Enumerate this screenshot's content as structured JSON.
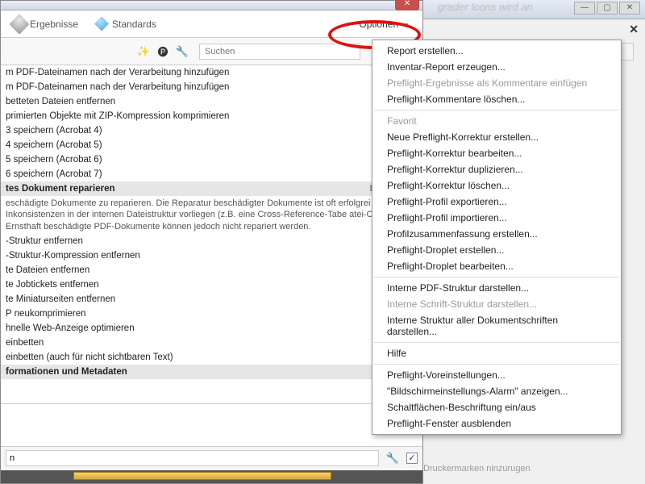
{
  "titlebar_bg_text": "grader  Icons wird an",
  "tabs": {
    "ergebnisse": "Ergebnisse",
    "standards": "Standards"
  },
  "options_label": "Optionen",
  "search_placeholder": "Suchen",
  "list_items": [
    {
      "t": "item",
      "text": "m PDF-Dateinamen nach der Verarbeitung hinzufügen"
    },
    {
      "t": "item",
      "text": "m PDF-Dateinamen nach der Verarbeitung hinzufügen"
    },
    {
      "t": "item",
      "text": "betteten Dateien entfernen"
    },
    {
      "t": "item",
      "text": "primierten Objekte mit ZIP-Kompression komprimieren"
    },
    {
      "t": "item",
      "text": "3 speichern (Acrobat 4)"
    },
    {
      "t": "item",
      "text": "4 speichern (Acrobat 5)"
    },
    {
      "t": "item",
      "text": "5 speichern (Acrobat 6)"
    },
    {
      "t": "item",
      "text": "6 speichern (Acrobat 7)"
    },
    {
      "t": "head",
      "text": "tes Dokument reparieren",
      "edit": "Bearbeiten.."
    },
    {
      "t": "desc",
      "text": "eschädigte Dokumente zu reparieren. Die Reparatur beschädigter Dokumente ist oft erfolgrei kleine Inkonsistenzen in der internen Dateistruktur vorliegen (z.B. eine Cross-Reference-Tabe atei-Offsets). Ernsthaft beschädigte PDF-Dokumente können jedoch nicht repariert werden."
    },
    {
      "t": "item",
      "text": "-Struktur entfernen"
    },
    {
      "t": "item",
      "text": "-Struktur-Kompression entfernen"
    },
    {
      "t": "item",
      "text": "te Dateien entfernen"
    },
    {
      "t": "item",
      "text": "te Jobtickets entfernen"
    },
    {
      "t": "item",
      "text": "te Miniaturseiten entfernen"
    },
    {
      "t": "item",
      "text": "P neukomprimieren"
    },
    {
      "t": "item",
      "text": "hnelle Web-Anzeige optimieren"
    },
    {
      "t": "item",
      "text": "einbetten"
    },
    {
      "t": "item",
      "text": "einbetten (auch für nicht sichtbaren Text)"
    },
    {
      "t": "head",
      "text": "formationen und Metadaten"
    }
  ],
  "footer_input": "n",
  "checkbox_checked": "✓",
  "bottom_cut_text": "Druckermarken ninzurugen",
  "dropdown": [
    {
      "t": "i",
      "label": "Report erstellen..."
    },
    {
      "t": "i",
      "label": "Inventar-Report erzeugen..."
    },
    {
      "t": "d",
      "label": "Preflight-Ergebnisse als Kommentare einfügen"
    },
    {
      "t": "i",
      "label": "Preflight-Kommentare löschen..."
    },
    {
      "t": "sep"
    },
    {
      "t": "d",
      "label": "Favorit"
    },
    {
      "t": "i",
      "label": "Neue Preflight-Korrektur erstellen..."
    },
    {
      "t": "i",
      "label": "Preflight-Korrektur bearbeiten..."
    },
    {
      "t": "i",
      "label": "Preflight-Korrektur duplizieren..."
    },
    {
      "t": "i",
      "label": "Preflight-Korrektur löschen..."
    },
    {
      "t": "i",
      "label": "Preflight-Profil exportieren..."
    },
    {
      "t": "i",
      "label": "Preflight-Profil importieren..."
    },
    {
      "t": "i",
      "label": "Profilzusammenfassung erstellen..."
    },
    {
      "t": "i",
      "label": "Preflight-Droplet erstellen..."
    },
    {
      "t": "i",
      "label": "Preflight-Droplet bearbeiten..."
    },
    {
      "t": "sep"
    },
    {
      "t": "i",
      "label": "Interne PDF-Struktur darstellen..."
    },
    {
      "t": "d",
      "label": "Interne Schrift-Struktur darstellen..."
    },
    {
      "t": "i",
      "label": "Interne Struktur aller Dokumentschriften darstellen..."
    },
    {
      "t": "sep"
    },
    {
      "t": "i",
      "label": "Hilfe"
    },
    {
      "t": "sep"
    },
    {
      "t": "i",
      "label": "Preflight-Voreinstellungen..."
    },
    {
      "t": "i",
      "label": "\"Bildschirmeinstellungs-Alarm\" anzeigen..."
    },
    {
      "t": "i",
      "label": "Schaltflächen-Beschriftung ein/aus"
    },
    {
      "t": "i",
      "label": "Preflight-Fenster ausblenden"
    }
  ]
}
